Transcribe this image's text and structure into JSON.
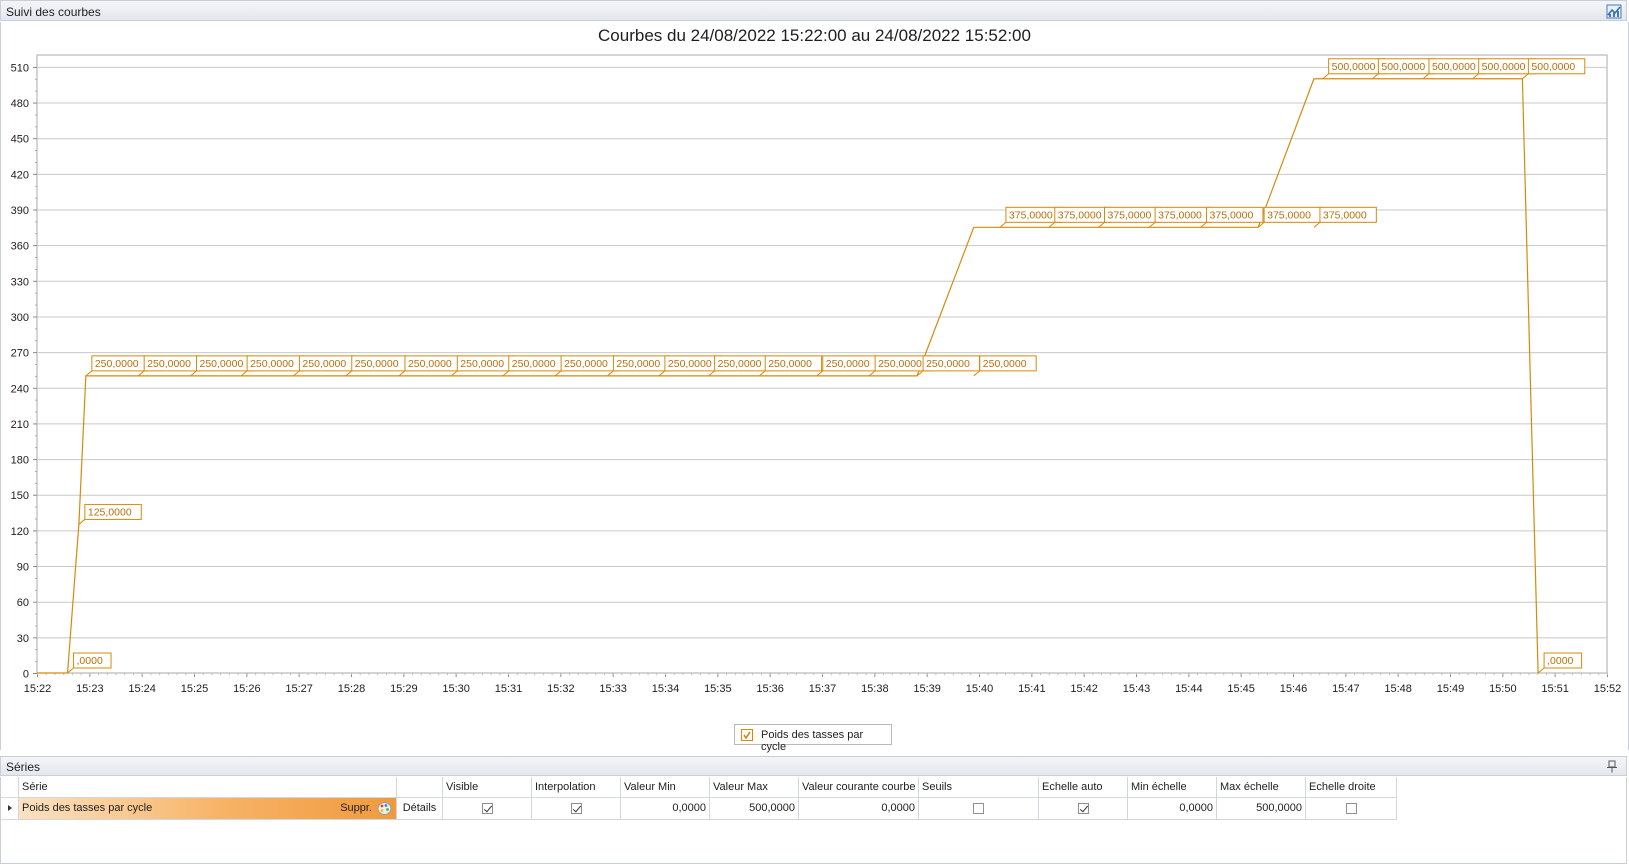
{
  "panel": {
    "title": "Suivi des courbes",
    "icon": "chart-icon"
  },
  "chart_title": "Courbes du 24/08/2022 15:22:00 au 24/08/2022 15:52:00",
  "legend": {
    "label": "Poids des tasses par cycle",
    "checked": true
  },
  "series_panel": {
    "title": "Séries"
  },
  "table": {
    "headers": {
      "serie": "Série",
      "visible": "Visible",
      "interpolation": "Interpolation",
      "valeur_min": "Valeur Min",
      "valeur_max": "Valeur Max",
      "valeur_courante": "Valeur courante courbe",
      "seuils": "Seuils",
      "echelle_auto": "Echelle auto",
      "min_echelle": "Min échelle",
      "max_echelle": "Max échelle",
      "echelle_droite": "Echelle droite"
    },
    "row": {
      "serie": "Poids des tasses par cycle",
      "suppr": "Suppr.",
      "details": "Détails",
      "visible": true,
      "interpolation": true,
      "valeur_min": "0,0000",
      "valeur_max": "500,0000",
      "valeur_courante": "0,0000",
      "seuils": false,
      "echelle_auto": true,
      "min_echelle": "0,0000",
      "max_echelle": "500,0000",
      "echelle_droite": false
    }
  },
  "chart_data": {
    "type": "line",
    "title": "Courbes du 24/08/2022 15:22:00 au 24/08/2022 15:52:00",
    "series_color": "#d8890a",
    "step": true,
    "x_unit": "time (HH:MM, 24/08/2022)",
    "xlim": [
      "15:22:00",
      "15:52:00"
    ],
    "ylim": [
      0,
      520
    ],
    "y_ticks": [
      0,
      30,
      60,
      90,
      120,
      150,
      180,
      210,
      240,
      270,
      300,
      330,
      360,
      390,
      420,
      450,
      480,
      510
    ],
    "x_ticks": [
      "15:22",
      "15:23",
      "15:24",
      "15:25",
      "15:26",
      "15:27",
      "15:28",
      "15:29",
      "15:30",
      "15:31",
      "15:32",
      "15:33",
      "15:34",
      "15:35",
      "15:36",
      "15:37",
      "15:38",
      "15:39",
      "15:40",
      "15:41",
      "15:42",
      "15:43",
      "15:44",
      "15:45",
      "15:46",
      "15:47",
      "15:48",
      "15:49",
      "15:50",
      "15:51",
      "15:52"
    ],
    "grid": true,
    "legend": "bottom-center",
    "series": [
      {
        "name": "Poids des tasses par cycle",
        "points": [
          {
            "t": "15:22:35",
            "v": 0,
            "label": ",0000"
          },
          {
            "t": "15:22:48",
            "v": 125,
            "label": "125,0000"
          },
          {
            "t": "15:22:56",
            "v": 250,
            "label": "250,0000"
          },
          {
            "t": "15:23:56",
            "v": 250,
            "label": "250,0000"
          },
          {
            "t": "15:24:56",
            "v": 250,
            "label": "250,0000"
          },
          {
            "t": "15:25:54",
            "v": 250,
            "label": "250,0000"
          },
          {
            "t": "15:26:54",
            "v": 250,
            "label": "250,0000"
          },
          {
            "t": "15:27:54",
            "v": 250,
            "label": "250,0000"
          },
          {
            "t": "15:28:55",
            "v": 250,
            "label": "250,0000"
          },
          {
            "t": "15:29:55",
            "v": 250,
            "label": "250,0000"
          },
          {
            "t": "15:30:54",
            "v": 250,
            "label": "250,0000"
          },
          {
            "t": "15:31:54",
            "v": 250,
            "label": "250,0000"
          },
          {
            "t": "15:32:54",
            "v": 250,
            "label": "250,0000"
          },
          {
            "t": "15:33:53",
            "v": 250,
            "label": "250,0000"
          },
          {
            "t": "15:34:50",
            "v": 250,
            "label": "250,0000"
          },
          {
            "t": "15:35:48",
            "v": 250,
            "label": "250,0000"
          },
          {
            "t": "15:36:54",
            "v": 250,
            "label": "250,0000"
          },
          {
            "t": "15:37:54",
            "v": 250,
            "label": "250,0000"
          },
          {
            "t": "15:38:49",
            "v": 250,
            "label": "250,0000"
          },
          {
            "t": "15:39:54",
            "v": 375,
            "label": "250,0000"
          },
          {
            "t": "15:40:24",
            "v": 375,
            "label": "375,0000"
          },
          {
            "t": "15:41:20",
            "v": 375,
            "label": "375,0000"
          },
          {
            "t": "15:42:17",
            "v": 375,
            "label": "375,0000"
          },
          {
            "t": "15:43:15",
            "v": 375,
            "label": "375,0000"
          },
          {
            "t": "15:44:14",
            "v": 375,
            "label": "375,0000"
          },
          {
            "t": "15:45:20",
            "v": 375,
            "label": "375,0000"
          },
          {
            "t": "15:46:24",
            "v": 500,
            "label": "375,0000"
          },
          {
            "t": "15:46:34",
            "v": 500,
            "label": "500,0000"
          },
          {
            "t": "15:47:31",
            "v": 500,
            "label": "500,0000"
          },
          {
            "t": "15:48:29",
            "v": 500,
            "label": "500,0000"
          },
          {
            "t": "15:49:26",
            "v": 500,
            "label": "500,0000"
          },
          {
            "t": "15:50:23",
            "v": 500,
            "label": "500,0000"
          },
          {
            "t": "15:50:41",
            "v": 0,
            "label": ",0000"
          }
        ]
      }
    ]
  }
}
